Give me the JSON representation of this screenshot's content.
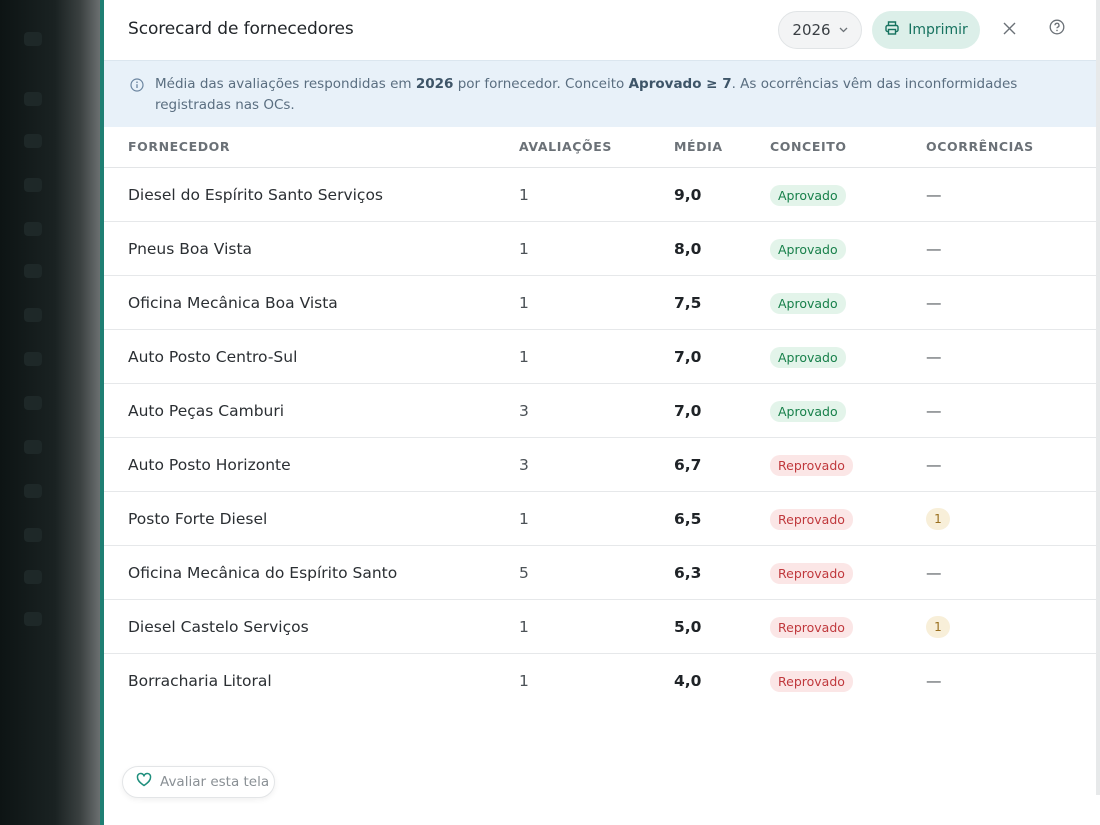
{
  "header": {
    "title": "Scorecard de fornecedores",
    "year": "2026",
    "print_label": "Imprimir"
  },
  "info": {
    "text_a": "Média das avaliações respondidas em ",
    "year": "2026",
    "text_b": " por fornecedor. Conceito ",
    "rule": "Aprovado ≥ 7",
    "text_c": ". As ocorrências vêm das inconformidades registradas nas OCs."
  },
  "table": {
    "columns": [
      "FORNECEDOR",
      "AVALIAÇÕES",
      "MÉDIA",
      "CONCEITO",
      "OCORRÊNCIAS"
    ],
    "rows": [
      {
        "name": "Diesel do Espírito Santo Serviços",
        "count": "1",
        "avg": "9,0",
        "status": "Aprovado",
        "ok": true,
        "occ": "—"
      },
      {
        "name": "Pneus Boa Vista",
        "count": "1",
        "avg": "8,0",
        "status": "Aprovado",
        "ok": true,
        "occ": "—"
      },
      {
        "name": "Oficina Mecânica Boa Vista",
        "count": "1",
        "avg": "7,5",
        "status": "Aprovado",
        "ok": true,
        "occ": "—"
      },
      {
        "name": "Auto Posto Centro-Sul",
        "count": "1",
        "avg": "7,0",
        "status": "Aprovado",
        "ok": true,
        "occ": "—"
      },
      {
        "name": "Auto Peças Camburi",
        "count": "3",
        "avg": "7,0",
        "status": "Aprovado",
        "ok": true,
        "occ": "—"
      },
      {
        "name": "Auto Posto Horizonte",
        "count": "3",
        "avg": "6,7",
        "status": "Reprovado",
        "ok": false,
        "occ": "—"
      },
      {
        "name": "Posto Forte Diesel",
        "count": "1",
        "avg": "6,5",
        "status": "Reprovado",
        "ok": false,
        "occ": "1"
      },
      {
        "name": "Oficina Mecânica do Espírito Santo",
        "count": "5",
        "avg": "6,3",
        "status": "Reprovado",
        "ok": false,
        "occ": "—"
      },
      {
        "name": "Diesel Castelo Serviços",
        "count": "1",
        "avg": "5,0",
        "status": "Reprovado",
        "ok": false,
        "occ": "1"
      },
      {
        "name": "Borracharia Litoral",
        "count": "1",
        "avg": "4,0",
        "status": "Reprovado",
        "ok": false,
        "occ": "—"
      }
    ]
  },
  "feedback": {
    "label": "Avaliar esta tela"
  },
  "colors": {
    "accent": "#1f7f73",
    "approved": "#17804a",
    "rejected": "#c0393d",
    "occurrence": "#9a6f1f"
  },
  "icons": {
    "year_select": "chevron-down-icon",
    "print": "printer-icon",
    "close": "close-icon",
    "help": "help-circle-icon",
    "info": "info-icon",
    "feedback": "heart-icon"
  }
}
